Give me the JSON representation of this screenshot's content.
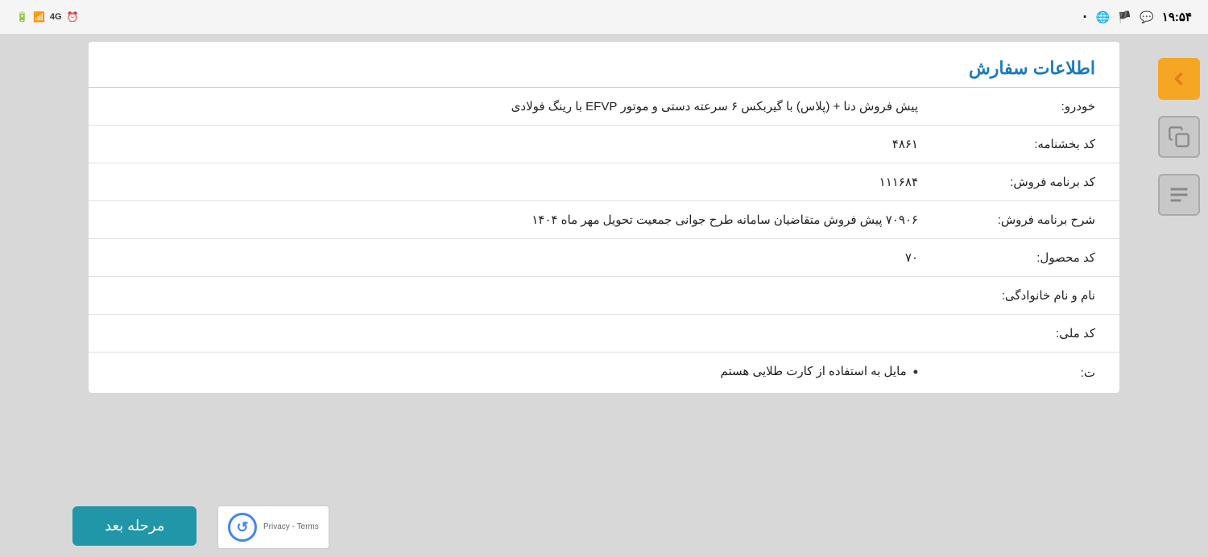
{
  "statusBar": {
    "time": "۱۹:۵۴",
    "signal": "📶",
    "battery": "🔋",
    "icons": [
      "signal1",
      "signal2",
      "4g",
      "clock"
    ]
  },
  "card": {
    "title": "اطلاعات سفارش",
    "rows": [
      {
        "label": "خودرو:",
        "value": "پیش فروش دنا + (پلاس) با گیربکس ۶ سرعته دستی و موتور EFVP با رینگ فولادی"
      },
      {
        "label": "کد بخشنامه:",
        "value": "۴۸۶۱"
      },
      {
        "label": "کد برنامه فروش:",
        "value": "۱۱۱۶۸۴"
      },
      {
        "label": "شرح برنامه فروش:",
        "value": "۷۰۹۰۶ پیش فروش متقاضیان سامانه طرح جوانی جمعیت تحویل مهر ماه ۱۴۰۴"
      },
      {
        "label": "کد محصول:",
        "value": "۷۰"
      },
      {
        "label": "نام و نام خانوادگی:",
        "value": ""
      },
      {
        "label": "کد ملی:",
        "value": ""
      },
      {
        "label": "ت:",
        "value": "• مایل به استفاده از کارت طلایی هستم"
      }
    ]
  },
  "buttons": {
    "next": "مرحله بعد",
    "back_icon": "←",
    "copy_icon": "⧉",
    "menu_icon": "☰"
  },
  "recaptcha": {
    "privacy": "Privacy",
    "separator": " - ",
    "terms": "Terms"
  }
}
